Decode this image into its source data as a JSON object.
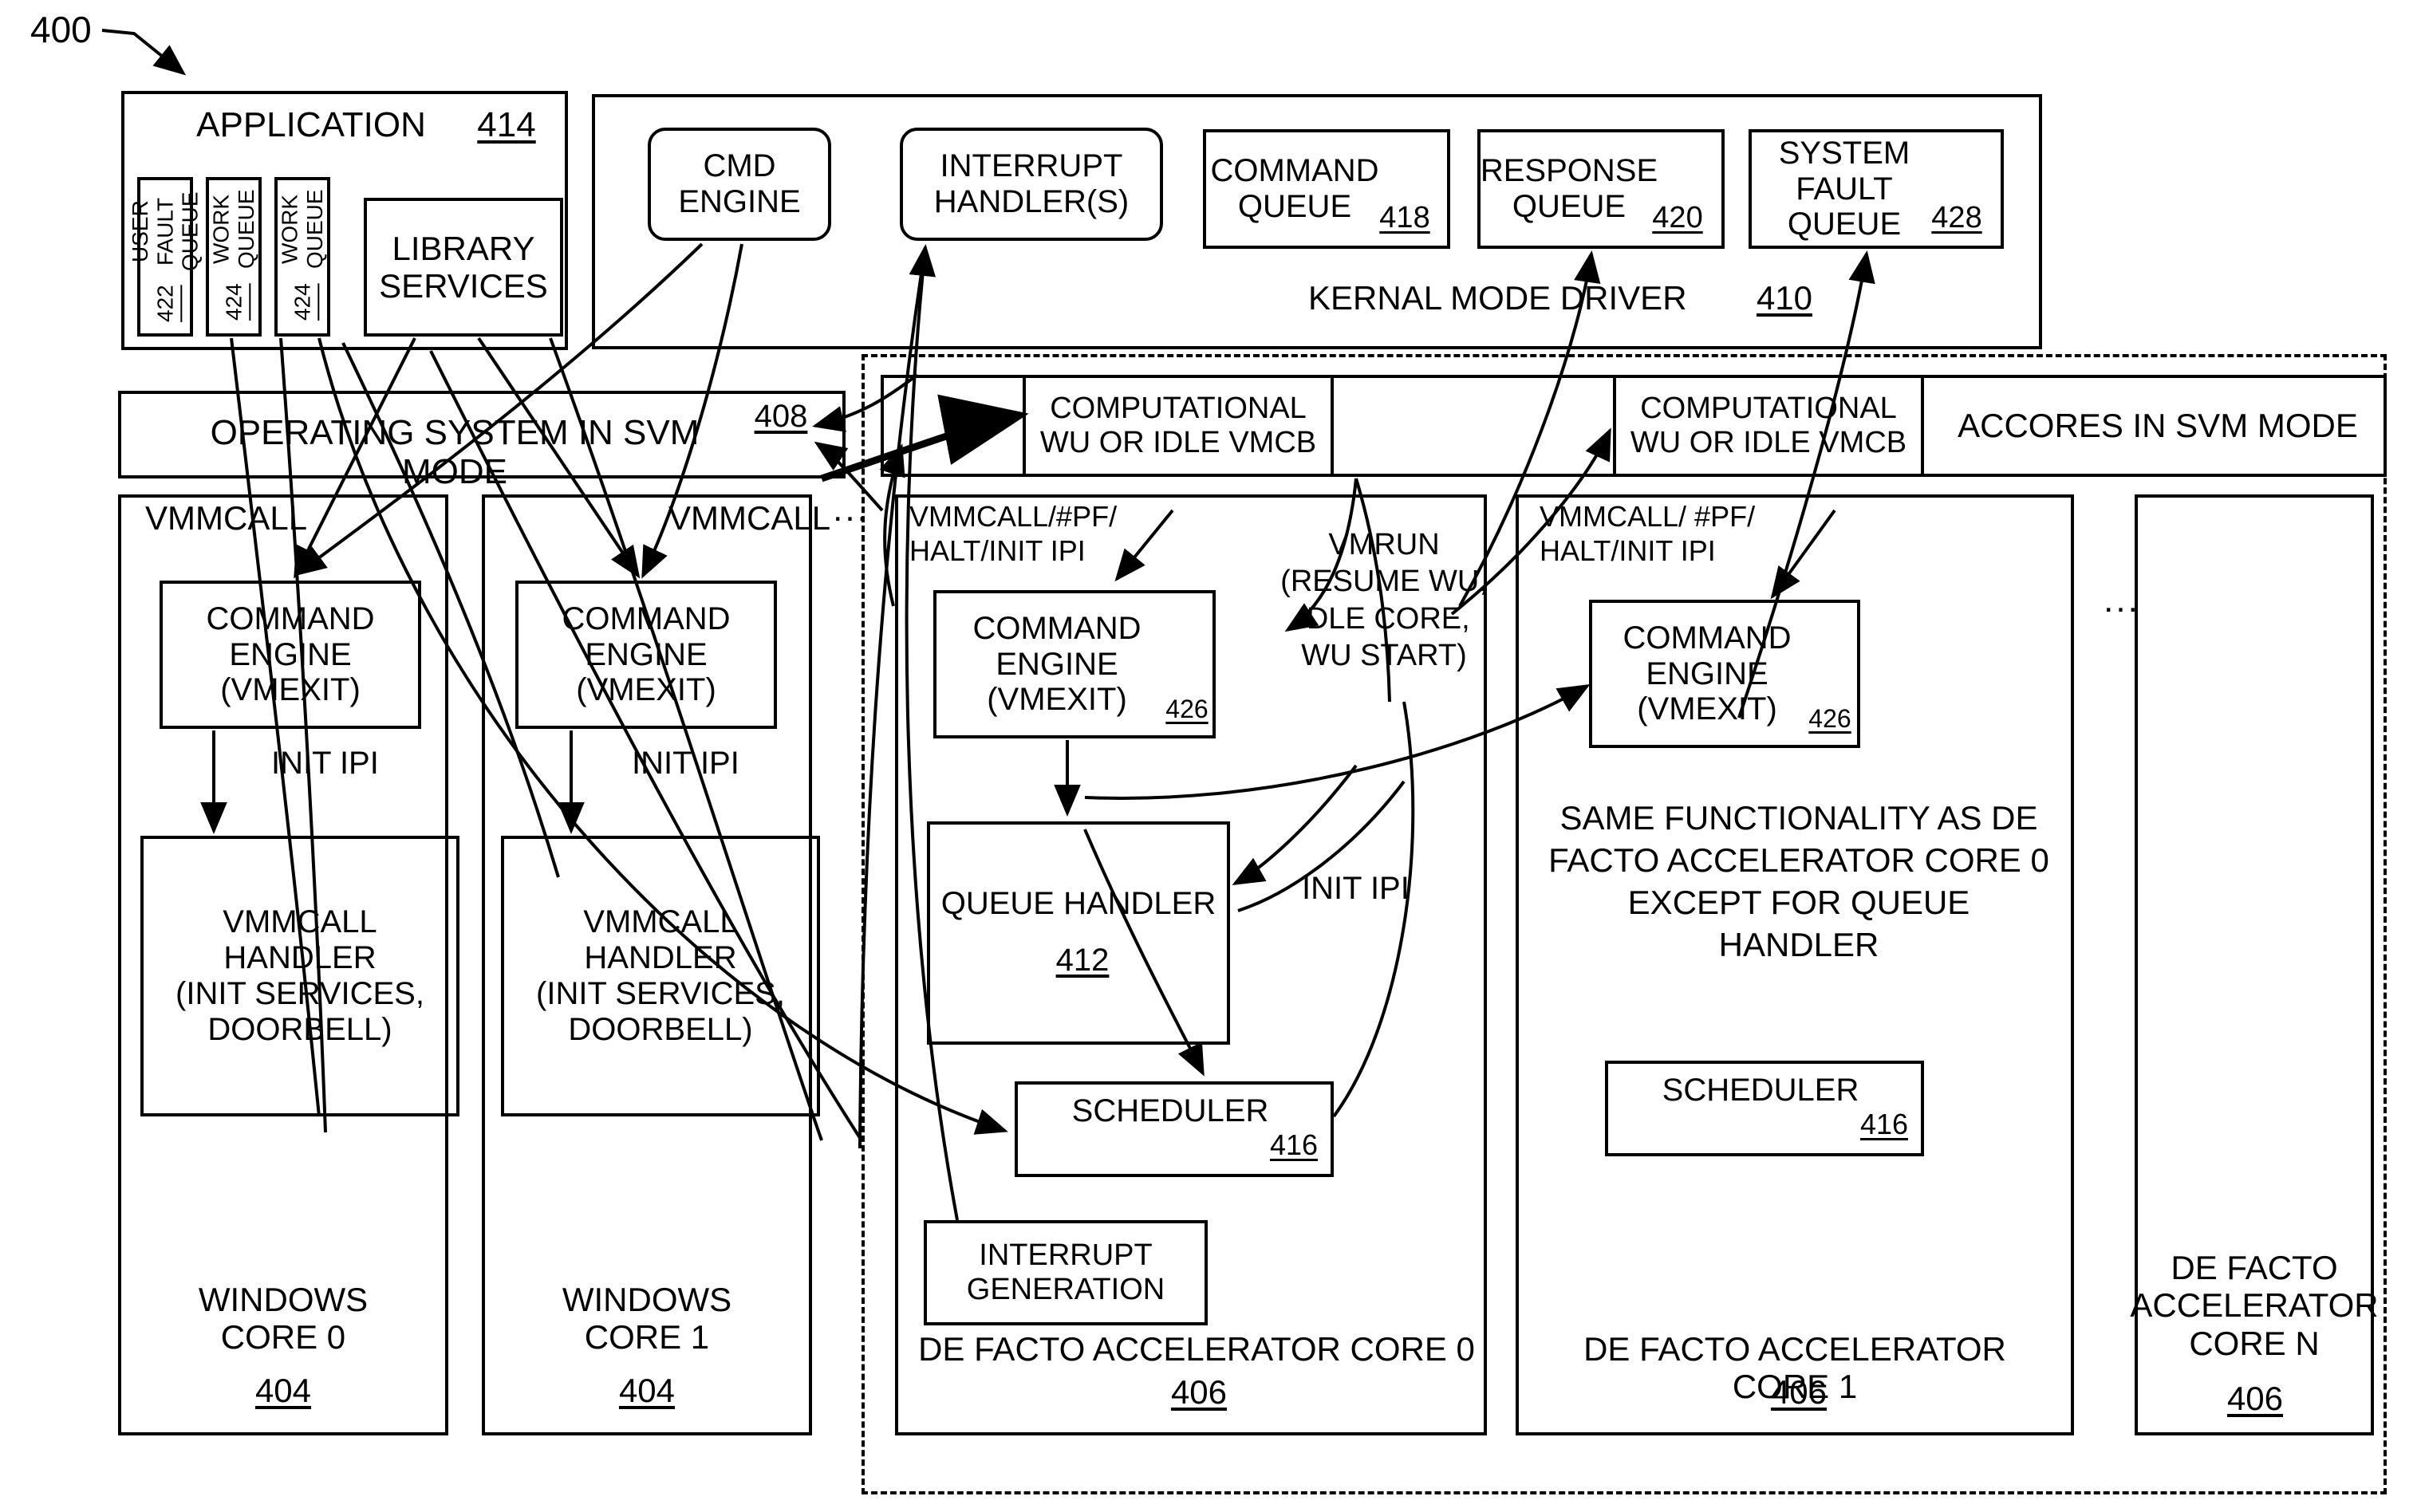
{
  "figure": {
    "number": "400"
  },
  "application": {
    "title": "APPLICATION",
    "ref": "414",
    "queues": [
      {
        "name": "USER FAULT\nQUEUE",
        "ref": "422"
      },
      {
        "name": "WORK\nQUEUE",
        "ref": "424"
      },
      {
        "name": "WORK\nQUEUE",
        "ref": "424"
      }
    ],
    "library_services": "LIBRARY\nSERVICES"
  },
  "kernel_driver": {
    "title": "KERNAL MODE DRIVER",
    "ref": "410",
    "cmd_engine": "CMD\nENGINE",
    "interrupt_handler": "INTERRUPT\nHANDLER(S)",
    "queues": [
      {
        "name": "COMMAND\nQUEUE",
        "ref": "418"
      },
      {
        "name": "RESPONSE\nQUEUE",
        "ref": "420"
      },
      {
        "name": "SYSTEM FAULT\nQUEUE",
        "ref": "428"
      }
    ]
  },
  "os_bar": {
    "label": "OPERATING SYSTEM IN SVM MODE",
    "ref": "408"
  },
  "accores_bar": {
    "vmcb_left": "COMPUTATIONAL\nWU OR IDLE VMCB",
    "vmcb_right": "COMPUTATIONAL\nWU OR IDLE VMCB",
    "label": "ACCORES IN SVM MODE"
  },
  "windows_cores": [
    {
      "vmmcall_label": "VMMCALL",
      "command_engine": "COMMAND\nENGINE\n(VMEXIT)",
      "edge_label": "INIT IPI",
      "handler": "VMMCALL\nHANDLER\n(INIT SERVICES,\nDOORBELL)",
      "footer": "WINDOWS\nCORE 0",
      "ref": "404"
    },
    {
      "vmmcall_label": "VMMCALL",
      "command_engine": "COMMAND\nENGINE\n(VMEXIT)",
      "edge_label": "INIT IPI",
      "handler": "VMMCALL\nHANDLER\n(INIT SERVICES,\nDOORBELL)",
      "footer": "WINDOWS\nCORE 1",
      "ref": "404"
    }
  ],
  "windows_ellipsis": "...",
  "accel_core_0": {
    "entry_label": "VMMCALL/#PF/\nHALT/INIT IPI",
    "command_engine": "COMMAND\nENGINE\n(VMEXIT)",
    "command_engine_ref": "426",
    "vmrun_label": "VMRUN\n(RESUME WU,\nIDLE CORE,\nWU START)",
    "queue_handler": "QUEUE HANDLER",
    "queue_handler_ref": "412",
    "init_ipi_label": "INIT IPI",
    "scheduler": "SCHEDULER",
    "scheduler_ref": "416",
    "interrupt_generation": "INTERRUPT\nGENERATION",
    "footer": "DE FACTO ACCELERATOR CORE 0",
    "ref": "406"
  },
  "accel_core_1": {
    "entry_label": "VMMCALL/ #PF/\nHALT/INIT IPI",
    "command_engine": "COMMAND\nENGINE\n(VMEXIT)",
    "command_engine_ref": "426",
    "note": "SAME FUNCTIONALITY AS  DE\nFACTO ACCELERATOR CORE 0\nEXCEPT FOR QUEUE\nHANDLER",
    "scheduler": "SCHEDULER",
    "scheduler_ref": "416",
    "footer": "DE FACTO ACCELERATOR CORE 1",
    "ref": "406"
  },
  "accel_ellipsis": "...",
  "accel_core_n": {
    "footer": "DE FACTO\nACCELERATOR\nCORE N",
    "ref": "406"
  },
  "colors": {
    "ink": "#000000",
    "paper": "#ffffff"
  }
}
